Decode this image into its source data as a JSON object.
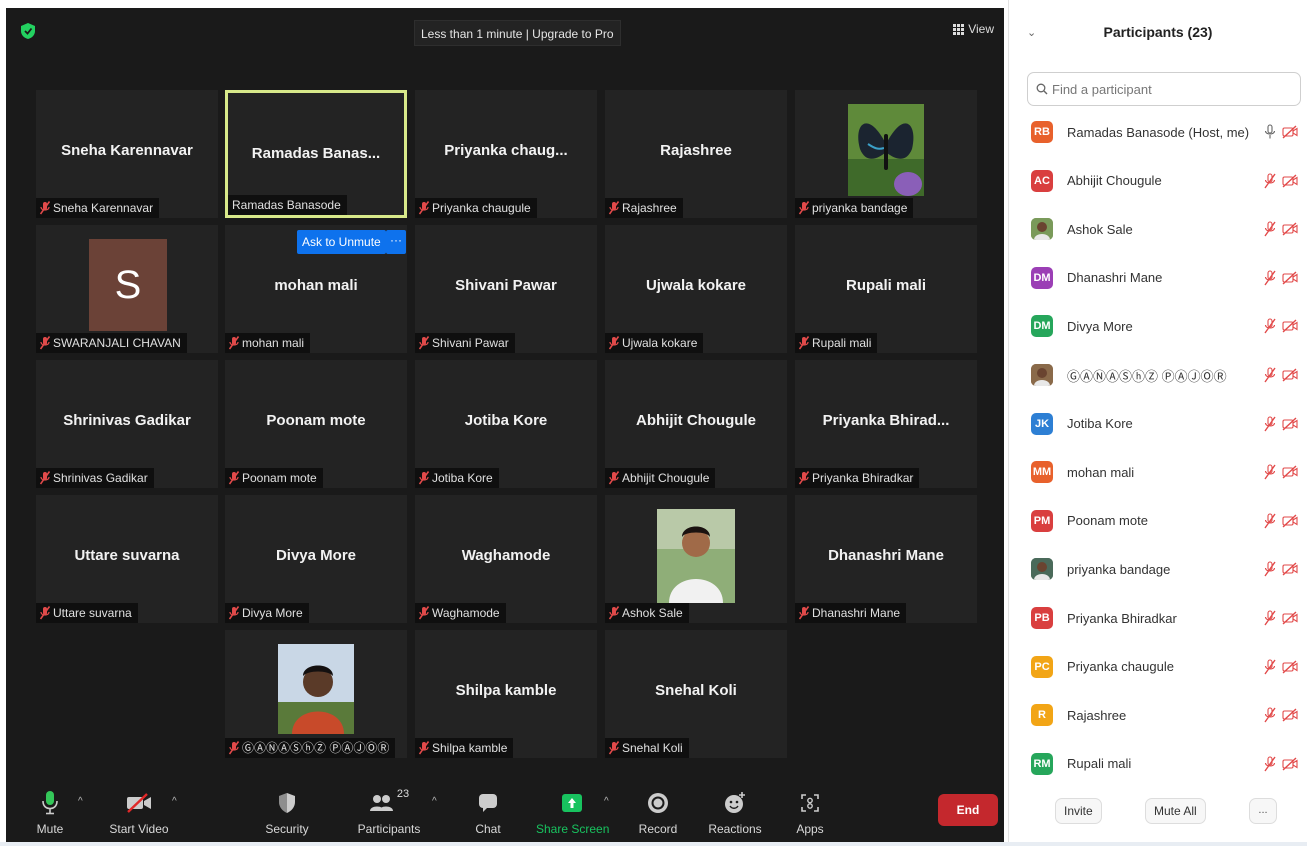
{
  "topbar": {
    "timer_text": "Less than 1 minute | Upgrade to Pro",
    "view_label": "View"
  },
  "tiles": [
    {
      "big": "Sneha Karennavar",
      "tag": "Sneha Karennavar",
      "muted": true
    },
    {
      "big": "Ramadas  Banas...",
      "tag": "Ramadas Banasode",
      "muted": false,
      "active": true
    },
    {
      "big": "Priyanka  chaug...",
      "tag": "Priyanka chaugule",
      "muted": true
    },
    {
      "big": "Rajashree",
      "tag": "Rajashree",
      "muted": true
    },
    {
      "big": "",
      "tag": "priyanka bandage",
      "muted": true,
      "photo": "butterfly"
    },
    {
      "big": "",
      "tag": "SWARANJALI CHAVAN",
      "muted": true,
      "letter": "S"
    },
    {
      "big": "mohan mali",
      "tag": "mohan mali",
      "muted": true
    },
    {
      "big": "Shivani Pawar",
      "tag": "Shivani Pawar",
      "muted": true
    },
    {
      "big": "Ujwala kokare",
      "tag": "Ujwala kokare",
      "muted": true
    },
    {
      "big": "Rupali mali",
      "tag": "Rupali mali",
      "muted": true
    },
    {
      "big": "Shrinivas Gadikar",
      "tag": "Shrinivas Gadikar",
      "muted": true
    },
    {
      "big": "Poonam mote",
      "tag": "Poonam mote",
      "muted": true
    },
    {
      "big": "Jotiba Kore",
      "tag": "Jotiba Kore",
      "muted": true
    },
    {
      "big": "Abhijit Chougule",
      "tag": "Abhijit Chougule",
      "muted": true
    },
    {
      "big": "Priyanka  Bhirad...",
      "tag": "Priyanka Bhiradkar",
      "muted": true
    },
    {
      "big": "Uttare suvarna",
      "tag": "Uttare suvarna",
      "muted": true
    },
    {
      "big": "Divya More",
      "tag": "Divya More",
      "muted": true
    },
    {
      "big": "Waghamode",
      "tag": "Waghamode",
      "muted": true
    },
    {
      "big": "",
      "tag": "Ashok Sale",
      "muted": true,
      "photo": "man-outdoor"
    },
    {
      "big": "Dhanashri Mane",
      "tag": "Dhanashri Mane",
      "muted": true
    },
    {
      "big": "",
      "tag": "ⒼⒶⓃⒶⓈⓗⓏ ⓅⒶⒿⓄⓇ",
      "muted": true,
      "photo": "young-man"
    },
    {
      "big": "Shilpa kamble",
      "tag": "Shilpa kamble",
      "muted": true
    },
    {
      "big": "Snehal Koli",
      "tag": "Snehal Koli",
      "muted": true
    }
  ],
  "hover_actions": {
    "ask_unmute": "Ask to Unmute",
    "more": "···"
  },
  "toolbar": {
    "mute": "Mute",
    "start_video": "Start Video",
    "security": "Security",
    "participants": "Participants",
    "participants_count": "23",
    "chat": "Chat",
    "share_screen": "Share Screen",
    "record": "Record",
    "reactions": "Reactions",
    "apps": "Apps",
    "end": "End"
  },
  "panel": {
    "title": "Participants (23)",
    "search_placeholder": "Find a participant",
    "invite": "Invite",
    "mute_all": "Mute All",
    "more": "..."
  },
  "participants": [
    {
      "initials": "RB",
      "name": "Ramadas Banasode (Host, me)",
      "color": "#e8612c",
      "mic": "on"
    },
    {
      "initials": "AC",
      "name": "Abhijit Chougule",
      "color": "#d93f3f",
      "mic": "muted"
    },
    {
      "initials": "",
      "name": "Ashok Sale",
      "color": "#7a9a5a",
      "mic": "muted",
      "photo": true
    },
    {
      "initials": "DM",
      "name": "Dhanashri Mane",
      "color": "#9b3fb5",
      "mic": "muted"
    },
    {
      "initials": "DM",
      "name": "Divya More",
      "color": "#26a65b",
      "mic": "muted"
    },
    {
      "initials": "",
      "name": "ⒼⒶⓃⒶⓈⓗⓏ ⓅⒶⒿⓄⓇ",
      "color": "#8a6a4a",
      "mic": "muted",
      "photo": true
    },
    {
      "initials": "JK",
      "name": "Jotiba Kore",
      "color": "#2d7fd4",
      "mic": "muted"
    },
    {
      "initials": "MM",
      "name": "mohan mali",
      "color": "#e8612c",
      "mic": "muted"
    },
    {
      "initials": "PM",
      "name": "Poonam mote",
      "color": "#d93f3f",
      "mic": "muted"
    },
    {
      "initials": "",
      "name": "priyanka bandage",
      "color": "#4a6a5a",
      "mic": "muted",
      "photo": true
    },
    {
      "initials": "PB",
      "name": "Priyanka Bhiradkar",
      "color": "#d93f3f",
      "mic": "muted"
    },
    {
      "initials": "PC",
      "name": "Priyanka chaugule",
      "color": "#f2a516",
      "mic": "muted"
    },
    {
      "initials": "R",
      "name": "Rajashree",
      "color": "#f2a516",
      "mic": "muted"
    },
    {
      "initials": "RM",
      "name": "Rupali mali",
      "color": "#26a65b",
      "mic": "muted"
    }
  ]
}
